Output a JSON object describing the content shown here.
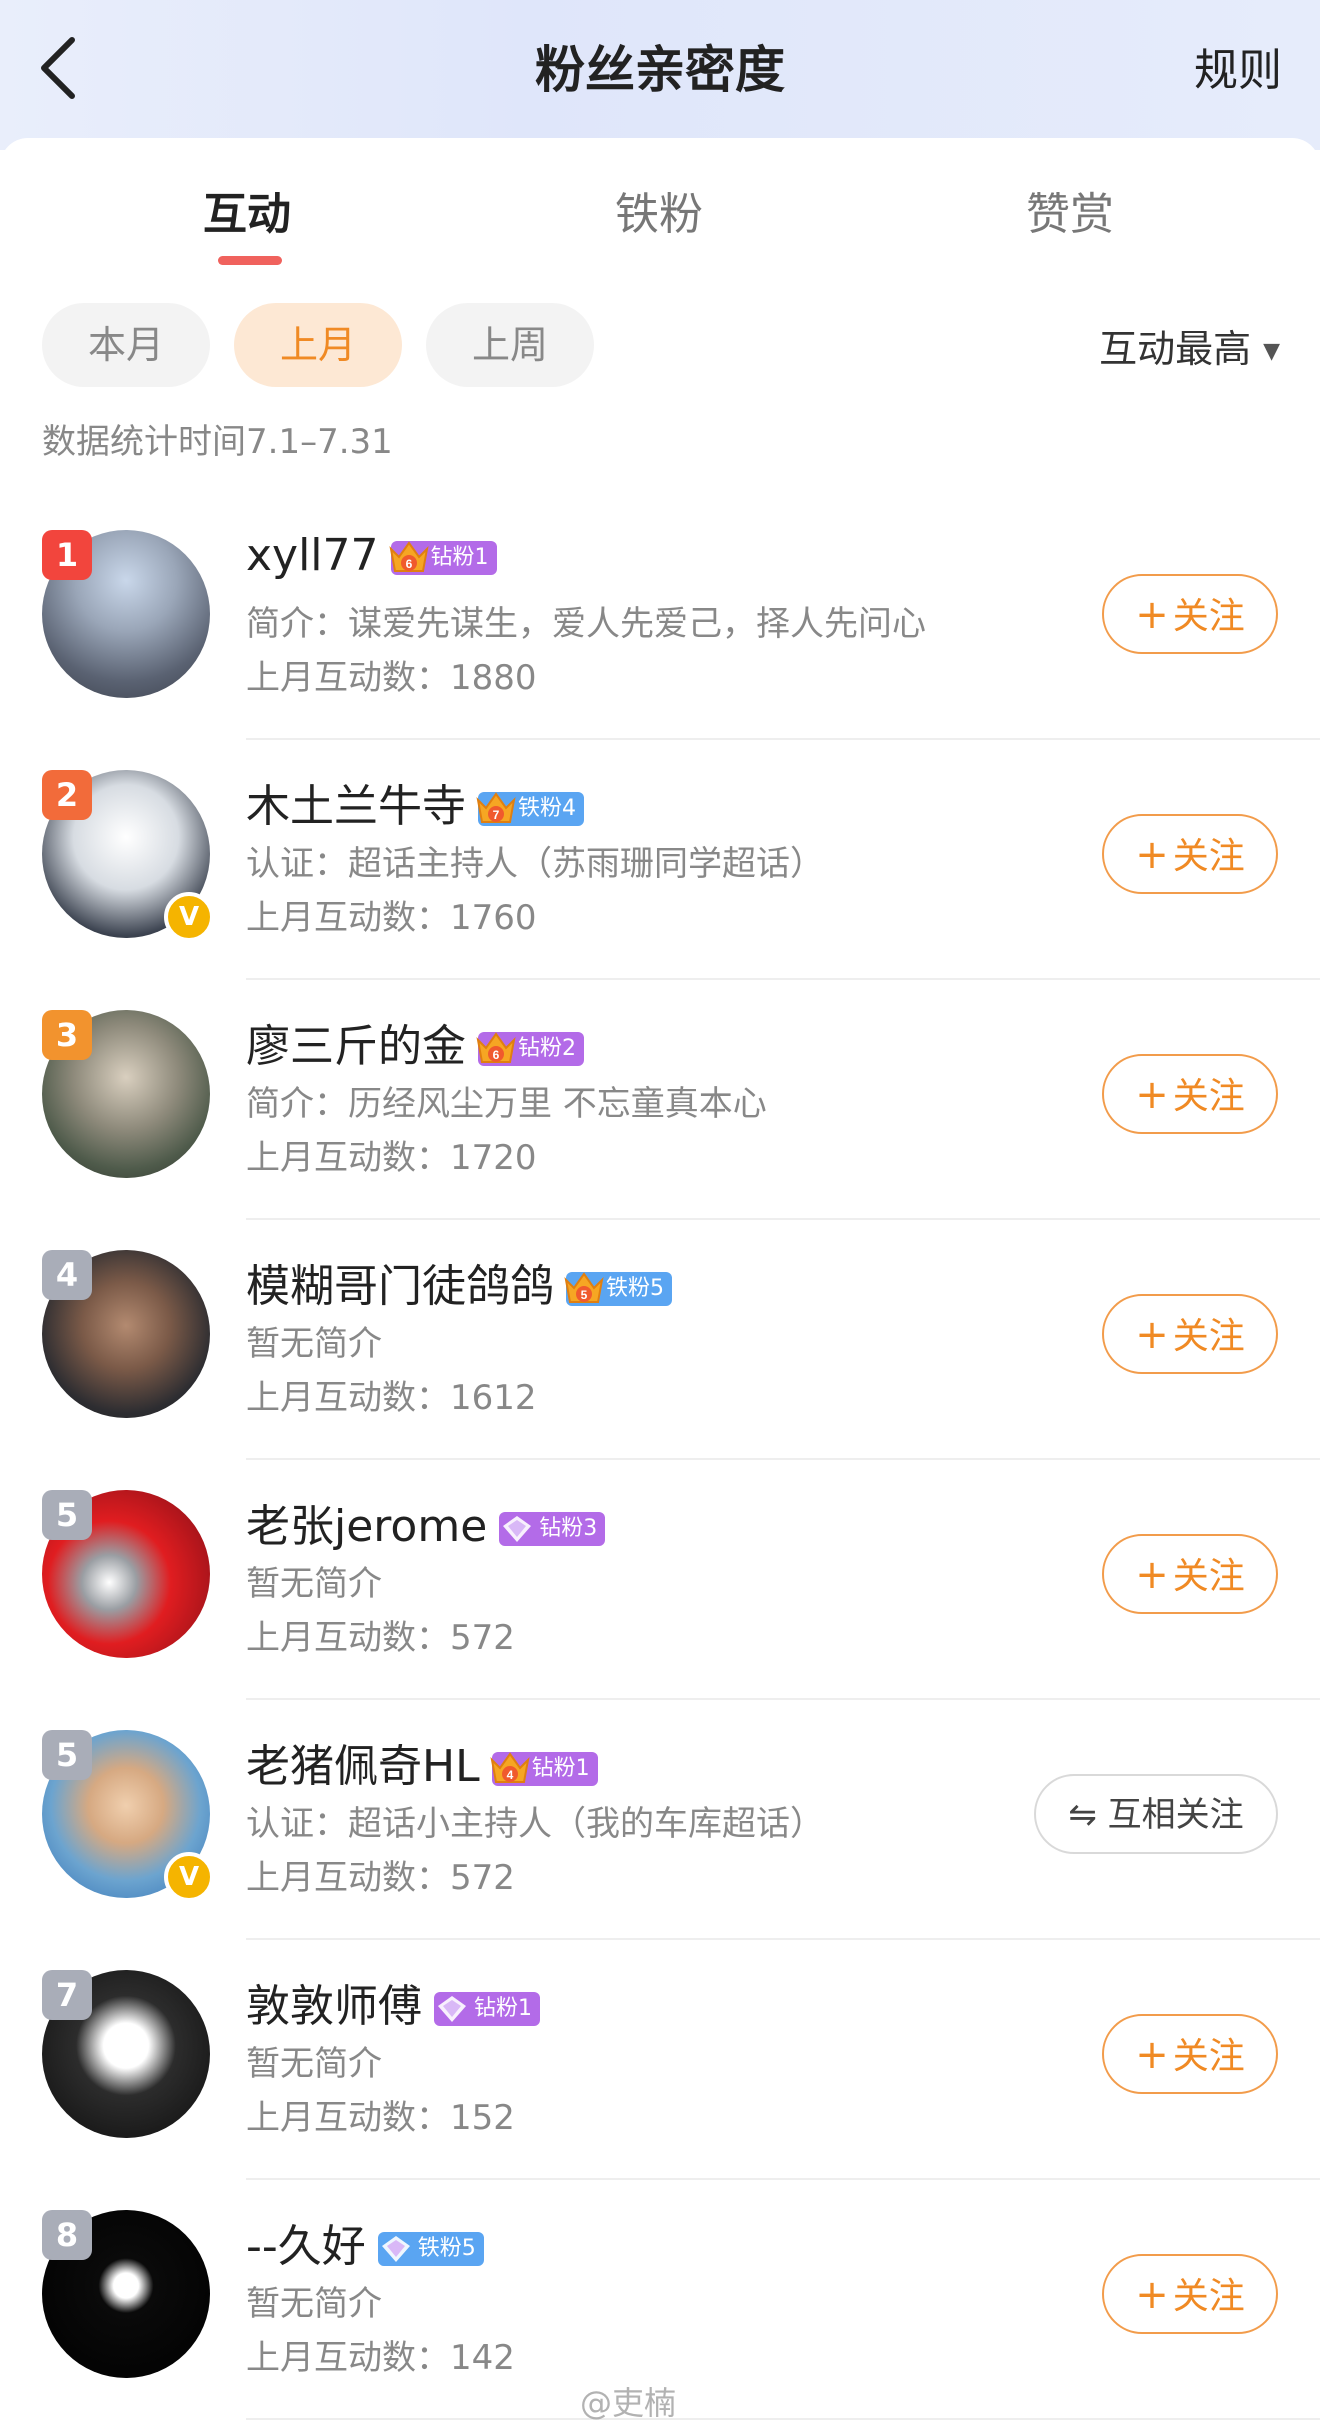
{
  "header": {
    "title": "粉丝亲密度",
    "rules": "规则"
  },
  "tabs": [
    {
      "label": "互动",
      "active": true
    },
    {
      "label": "铁粉",
      "active": false
    },
    {
      "label": "赞赏",
      "active": false
    }
  ],
  "filters": [
    {
      "label": "本月",
      "active": false
    },
    {
      "label": "上月",
      "active": true
    },
    {
      "label": "上周",
      "active": false
    }
  ],
  "sort": {
    "label": "互动最高"
  },
  "stat_time": "数据统计时间7.1–7.31",
  "buttons": {
    "follow": "关注",
    "mutual": "互相关注"
  },
  "colors": {
    "accent": "#f08a24",
    "tab_underline": "#f0625d",
    "badge_purple": "#b36be8",
    "badge_blue": "#5aa5f2"
  },
  "fans": [
    {
      "rank": "1",
      "name": "xyll77",
      "crown_level": "6",
      "badge": "钻粉1",
      "badge_color": "purple",
      "emblem": "crown-icon",
      "intro": "简介：谋爱先谋生，爱人先爱己，择人先问心",
      "count": "上月互动数：1880",
      "verified": false,
      "action": "follow"
    },
    {
      "rank": "2",
      "name": "木土兰牛寺",
      "crown_level": "7",
      "badge": "铁粉4",
      "badge_color": "blue",
      "emblem": "crown-icon",
      "intro": "认证：超话主持人（苏雨珊同学超话）",
      "count": "上月互动数：1760",
      "verified": true,
      "action": "follow"
    },
    {
      "rank": "3",
      "name": "廖三斤的金",
      "crown_level": "6",
      "badge": "钻粉2",
      "badge_color": "purple",
      "emblem": "crown-icon",
      "intro": "简介：历经风尘万里 不忘童真本心",
      "count": "上月互动数：1720",
      "verified": false,
      "action": "follow"
    },
    {
      "rank": "4",
      "name": "模糊哥门徒鸽鸽",
      "crown_level": "5",
      "badge": "铁粉5",
      "badge_color": "blue",
      "emblem": "crown-icon",
      "intro": "暂无简介",
      "count": "上月互动数：1612",
      "verified": false,
      "action": "follow"
    },
    {
      "rank": "5",
      "name": "老张jerome",
      "crown_level": "",
      "badge": "钻粉3",
      "badge_color": "purple",
      "emblem": "diamond-icon",
      "intro": "暂无简介",
      "count": "上月互动数：572",
      "verified": false,
      "action": "follow"
    },
    {
      "rank": "5",
      "name": "老猪佩奇HL",
      "crown_level": "4",
      "badge": "钻粉1",
      "badge_color": "purple",
      "emblem": "crown-icon",
      "intro": "认证：超话小主持人（我的车库超话）",
      "count": "上月互动数：572",
      "verified": true,
      "action": "mutual"
    },
    {
      "rank": "7",
      "name": "敦敦师傅",
      "crown_level": "",
      "badge": "钻粉1",
      "badge_color": "purple",
      "emblem": "diamond-icon",
      "intro": "暂无简介",
      "count": "上月互动数：152",
      "verified": false,
      "action": "follow"
    },
    {
      "rank": "8",
      "name": "--久好",
      "crown_level": "",
      "badge": "铁粉5",
      "badge_color": "blue",
      "emblem": "diamond-icon",
      "intro": "暂无简介",
      "count": "上月互动数：142",
      "verified": false,
      "action": "follow"
    }
  ],
  "watermark": "@吏楠"
}
